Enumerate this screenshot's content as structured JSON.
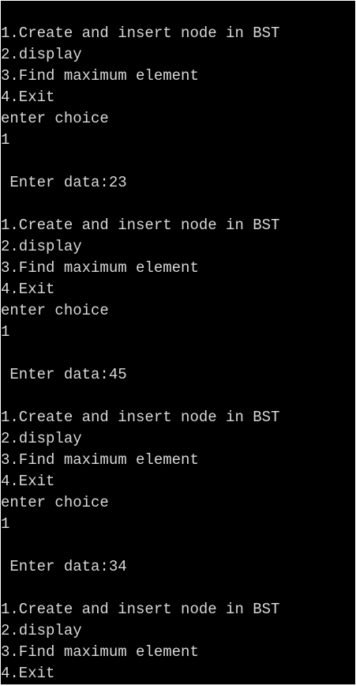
{
  "terminal": {
    "colors": {
      "background": "#000000",
      "text": "#d8d8d8"
    },
    "lines": [
      "1.Create and insert node in BST",
      "2.display",
      "3.Find maximum element",
      "4.Exit",
      "enter choice",
      "1",
      "",
      " Enter data:23",
      "",
      "1.Create and insert node in BST",
      "2.display",
      "3.Find maximum element",
      "4.Exit",
      "enter choice",
      "1",
      "",
      " Enter data:45",
      "",
      "1.Create and insert node in BST",
      "2.display",
      "3.Find maximum element",
      "4.Exit",
      "enter choice",
      "1",
      "",
      " Enter data:34",
      "",
      "1.Create and insert node in BST",
      "2.display",
      "3.Find maximum element",
      "4.Exit"
    ]
  }
}
